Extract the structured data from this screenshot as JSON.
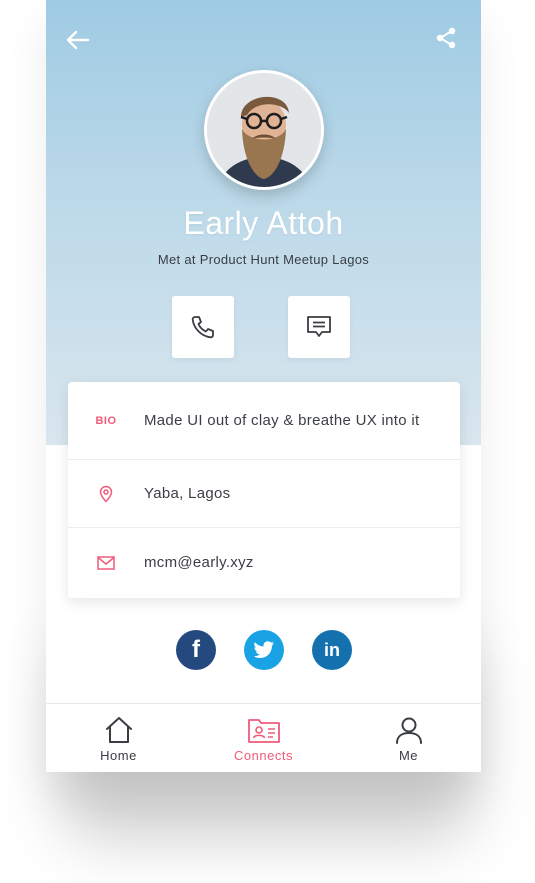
{
  "header": {
    "back_icon": "arrow-left-icon",
    "share_icon": "share-icon"
  },
  "profile": {
    "name": "Early Attoh",
    "subtitle": "Met at Product Hunt Meetup Lagos",
    "avatar": "avatar-photo"
  },
  "actions": {
    "call_icon": "phone-icon",
    "message_icon": "message-icon"
  },
  "details": {
    "bio_tag": "BIO",
    "bio": "Made UI out of clay & breathe UX into it",
    "location": "Yaba, Lagos",
    "email": "mcm@early.xyz"
  },
  "social": {
    "facebook": "f",
    "twitter": "twitter-bird-icon",
    "linkedin": "in"
  },
  "tabs": [
    {
      "label": "Home",
      "icon": "home-icon"
    },
    {
      "label": "Connects",
      "icon": "contacts-folder-icon"
    },
    {
      "label": "Me",
      "icon": "user-icon"
    }
  ],
  "colors": {
    "accent": "#ef5b7a",
    "hero_top": "#9fcbe3",
    "facebook": "#23497f",
    "twitter": "#1aa3e4",
    "linkedin": "#1571ae"
  }
}
